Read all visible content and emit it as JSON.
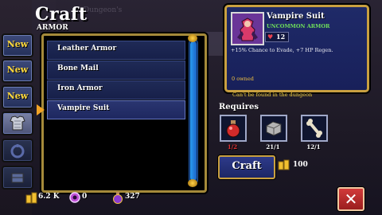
{
  "header": {
    "title": "Craft",
    "subtitle": "ARMOR",
    "faded_title": "Dungeon's"
  },
  "tabs": [
    {
      "label": "New",
      "icon": "new-badge"
    },
    {
      "label": "New",
      "icon": "new-badge"
    },
    {
      "label": "New",
      "icon": "new-badge"
    },
    {
      "label": "",
      "icon": "armor-icon",
      "selected": true
    },
    {
      "label": "",
      "icon": "ring-icon"
    },
    {
      "label": "",
      "icon": "block-icon"
    }
  ],
  "list": {
    "items": [
      {
        "label": "Leather Armor"
      },
      {
        "label": "Bone Mail"
      },
      {
        "label": "Iron Armor"
      },
      {
        "label": "Vampire Suit",
        "selected": true
      }
    ]
  },
  "item": {
    "name": "Vampire Suit",
    "rarity": "UNCOMMON ARMOR",
    "stat_value": "12",
    "description": "+15% Chance to Evade, +7 HP Regen.",
    "owned": "0 owned",
    "note": "Can't be found in the dungeon"
  },
  "requires": {
    "label": "Requires",
    "slots": [
      {
        "icon": "potion-icon",
        "count": "1/2",
        "color": "#e03030"
      },
      {
        "icon": "stone-block-icon",
        "count": "21/1",
        "color": "#ffffff"
      },
      {
        "icon": "bone-icon",
        "count": "12/1",
        "color": "#ffffff"
      }
    ]
  },
  "craft": {
    "label": "Craft",
    "cost": "100"
  },
  "currency": {
    "gold": "6.2 K",
    "gems": "0",
    "potions": "327"
  },
  "close_label": "✕"
}
